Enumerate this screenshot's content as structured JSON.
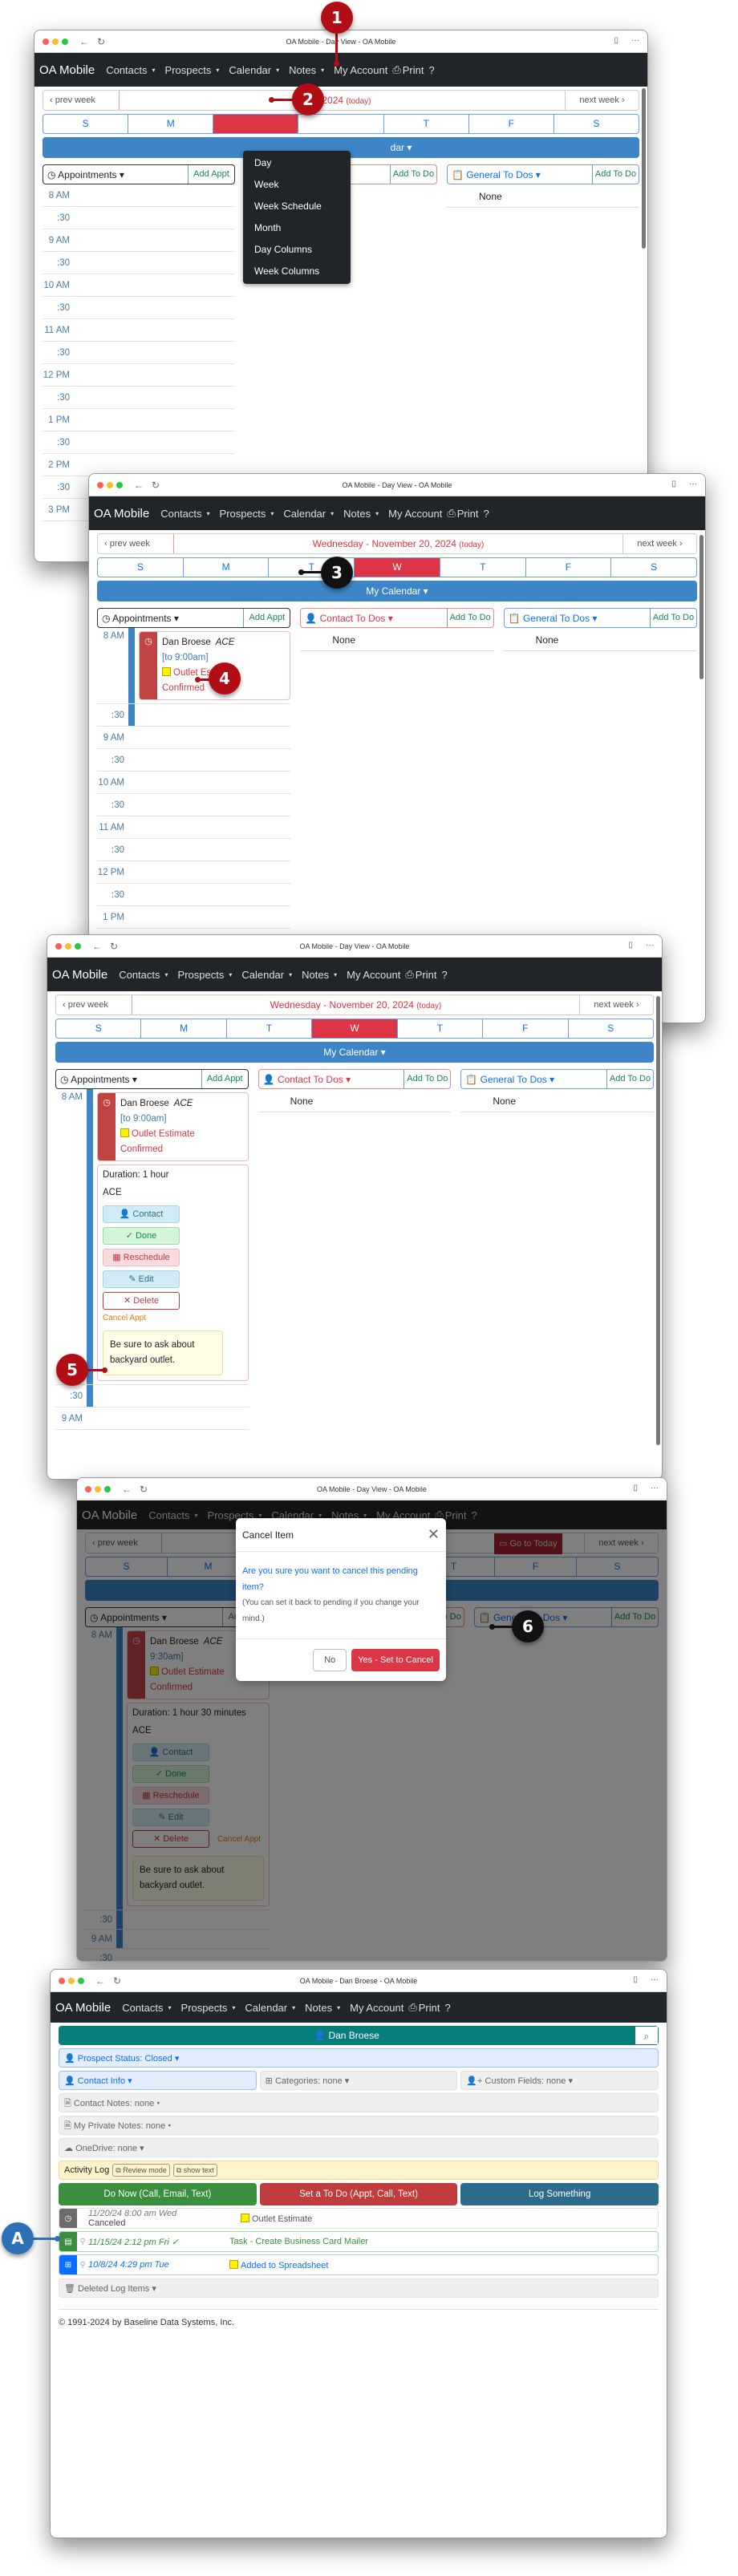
{
  "browser": {
    "day_view_title": "OA Mobile - Day View - OA Mobile",
    "contact_title": "OA Mobile - Dan Broese - OA Mobile",
    "back_icon": "←",
    "reload_icon": "↻",
    "reader_icon": "▯",
    "more_icon": "···"
  },
  "navbar": {
    "brand": "OA Mobile",
    "items": [
      {
        "label": "Contacts",
        "has_caret": true
      },
      {
        "label": "Prospects",
        "has_caret": true
      },
      {
        "label": "Calendar",
        "has_caret": true
      },
      {
        "label": "Notes",
        "has_caret": true
      },
      {
        "label": "My Account",
        "has_caret": false
      },
      {
        "label": "Print",
        "has_caret": false,
        "icon": "printer-icon"
      },
      {
        "label": "?",
        "has_caret": false
      }
    ],
    "caret": "▾",
    "print_glyph": "⎙"
  },
  "calendar_menu": {
    "items": [
      "Day",
      "Week",
      "Week Schedule",
      "Month",
      "Day Columns",
      "Week Columns"
    ]
  },
  "date_nav": {
    "prev": "‹ prev week",
    "next": "next week ›",
    "date_partial": "r 19, 2024",
    "date": "Wednesday - November 20, 2024",
    "today": "(today)",
    "go_to_today": "Go to Today"
  },
  "week_days": [
    "S",
    "M",
    "T",
    "W",
    "T",
    "F",
    "S"
  ],
  "my_calendar": {
    "label": "My Calendar ▾",
    "partial": "dar ▾"
  },
  "columns": {
    "appointments": {
      "label": "Appointments ▾",
      "add": "Add Appt"
    },
    "contact_todos": {
      "label": "Contact To Dos ▾",
      "add": "Add To Do",
      "empty": "None"
    },
    "general_todos": {
      "label": "General To Dos ▾",
      "add": "Add To Do",
      "empty": "None"
    }
  },
  "time_slots": [
    "8 AM",
    ":30",
    "9 AM",
    ":30",
    "10 AM",
    ":30",
    "11 AM",
    ":30",
    "12 PM",
    ":30",
    "1 PM",
    ":30",
    "2 PM",
    ":30",
    "3 PM"
  ],
  "appointment": {
    "name": "Dan Broese",
    "tag": "ACE",
    "end_time": "[to 9:00am]",
    "end_time_alt": "9:30am]",
    "subject": "Outlet Estimate",
    "status": "Confirmed",
    "duration": "Duration: 1 hour",
    "duration_alt": "Duration: 1 hour 30 minutes",
    "company": "ACE",
    "buttons": {
      "contact": "Contact",
      "done": "✓ Done",
      "reschedule": "Reschedule",
      "edit": "Edit",
      "delete": "✕ Delete"
    },
    "cancel_link": "Cancel Appt",
    "note": "Be sure to ask about backyard outlet."
  },
  "cancel_modal": {
    "title": "Cancel Item",
    "question": "Are you sure you want to cancel this pending item?",
    "sub": "(You can set it back to pending if you change your mind.)",
    "no": "No",
    "yes": "Yes - Set to Cancel"
  },
  "contact_page": {
    "name": "Dan Broese",
    "prospect_status": "Prospect Status: Closed ▾",
    "contact_info": "Contact Info ▾",
    "categories": "Categories: none ▾",
    "custom_fields": "Custom Fields: none ▾",
    "contact_notes": "Contact Notes: none ▾",
    "private_notes": "My Private Notes: none ▾",
    "onedrive": "OneDrive: none ▾",
    "activity_log": "Activity Log",
    "review_mode": "Review mode",
    "show_text": "show text",
    "actions": [
      "Do Now (Call, Email, Text)",
      "Set a To Do (Appt, Call, Text)",
      "Log Something"
    ],
    "log": [
      {
        "date": "11/20/24 8:00 am Wed",
        "status": "Canceled",
        "text": "Outlet Estimate",
        "type": "appointment",
        "swatch": true
      },
      {
        "date": "11/15/24 2:12 pm Fri ✓",
        "status": "",
        "text": "Task - Create Business Card Mailer",
        "type": "task",
        "swatch": false
      },
      {
        "date": "10/8/24 4:29 pm Tue",
        "status": "",
        "text": "Added to Spreadsheet",
        "type": "spreadsheet",
        "swatch": true
      }
    ],
    "deleted_items": "Deleted Log Items ▾",
    "copyright": "© 1991-2024 by Baseline Data Systems, Inc."
  },
  "callouts": [
    "1",
    "2",
    "3",
    "4",
    "5",
    "6",
    "A"
  ],
  "colors": {
    "accent_red": "#dc3545",
    "callout_red": "#b00d14",
    "calendar_blue": "#3d85c6",
    "contact_teal": "#067e7c",
    "navbar": "#212529"
  }
}
